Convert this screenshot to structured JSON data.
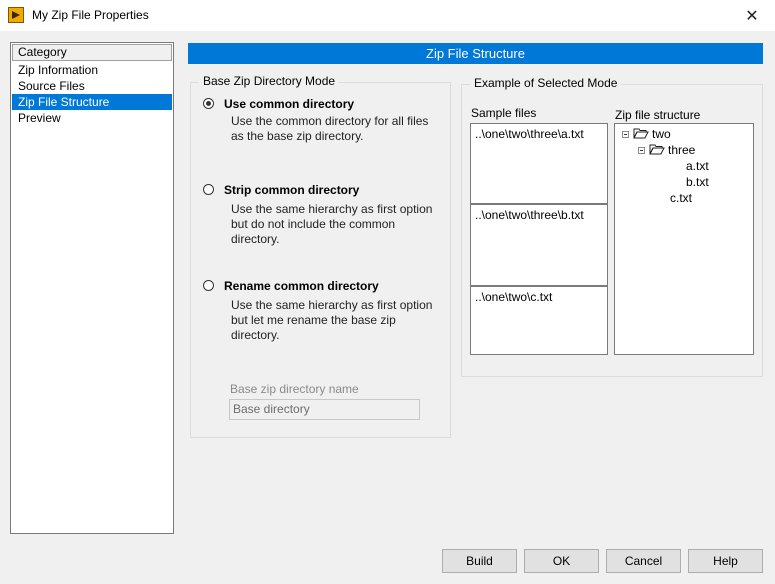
{
  "window": {
    "title": "My Zip File Properties",
    "close_glyph": "✕"
  },
  "category": {
    "header": "Category",
    "items": [
      {
        "label": "Zip Information"
      },
      {
        "label": "Source Files"
      },
      {
        "label": "Zip File Structure",
        "selected": true
      },
      {
        "label": "Preview"
      }
    ]
  },
  "section": {
    "title": "Zip File Structure"
  },
  "mode_group": {
    "title": "Base Zip Directory Mode",
    "options": [
      {
        "label": "Use common directory",
        "desc": "Use the common directory for all files as the base zip directory.",
        "checked": true
      },
      {
        "label": "Strip common directory",
        "desc": "Use the same hierarchy as first option but do not include the common directory.",
        "checked": false
      },
      {
        "label": "Rename common directory",
        "desc": "Use the same hierarchy as first option but let me rename the base zip directory.",
        "checked": false
      }
    ],
    "name_field": {
      "label": "Base zip directory name",
      "value": "Base directory"
    }
  },
  "example_group": {
    "title": "Example of Selected Mode",
    "sample_label": "Sample files",
    "samples": [
      "..\\one\\two\\three\\a.txt",
      "..\\one\\two\\three\\b.txt",
      "..\\one\\two\\c.txt"
    ],
    "tree_label": "Zip file structure",
    "tree": [
      {
        "label": "two",
        "folder": true
      },
      {
        "label": "three",
        "folder": true
      },
      {
        "label": "a.txt",
        "folder": false
      },
      {
        "label": "b.txt",
        "folder": false
      },
      {
        "label": "c.txt",
        "folder": false
      }
    ]
  },
  "buttons": {
    "build": "Build",
    "ok": "OK",
    "cancel": "Cancel",
    "help": "Help"
  },
  "colors": {
    "accent": "#0078d7",
    "window_bg": "#f0f0f0"
  }
}
